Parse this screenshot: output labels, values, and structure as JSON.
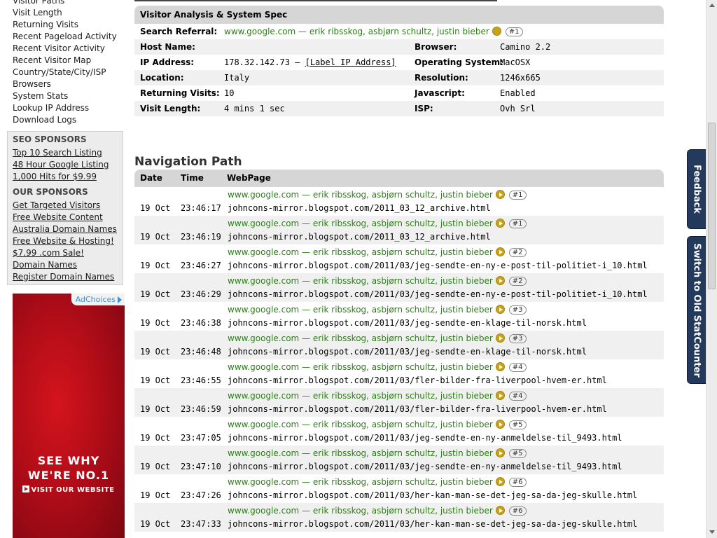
{
  "sidebar": {
    "links": [
      "Visitor Paths",
      "Visit Length",
      "Returning Visits",
      "Recent Pageload Activity",
      "Recent Visitor Activity",
      "Recent Visitor Map",
      "Country/State/City/ISP",
      "Browsers",
      "System Stats",
      "Lookup IP Address",
      "Download Logs"
    ],
    "seo_heading": "SEO SPONSORS",
    "seo_links": [
      "Top 10 Search Listing",
      "48 Hour Google Listing",
      "1,000 Hits for $9.99"
    ],
    "our_heading": "OUR SPONSORS",
    "our_links": [
      "Get Targeted Visitors",
      "Free Website Content",
      "Australia Domain Names",
      "Free Website & Hosting!",
      "$7.99 .com Sale!",
      "Domain Names",
      "Register Domain Names"
    ]
  },
  "ad": {
    "choices_label": "AdChoices",
    "headline_line1": "SEE WHY",
    "headline_line2": "WE'RE NO.1",
    "cta": "VISIT OUR WEBSITE"
  },
  "spec": {
    "title": "Visitor Analysis & System Spec",
    "search_referral_label": "Search Referral:",
    "search_referral_value": "www.google.com — erik ribsskog, asbjørn schultz, justin bieber",
    "search_referral_rank": "#1",
    "host_name_label": "Host Name:",
    "host_name_value": "",
    "browser_label": "Browser:",
    "browser_value": "Camino 2.2",
    "ip_label": "IP Address:",
    "ip_value": "178.32.142.73 —",
    "ip_link": "[Label IP Address]",
    "os_label": "Operating System:",
    "os_value": "MacOSX",
    "location_label": "Location:",
    "location_value": "Italy",
    "resolution_label": "Resolution:",
    "resolution_value": "1246x665",
    "returning_label": "Returning Visits:",
    "returning_value": "10",
    "javascript_label": "Javascript:",
    "javascript_value": "Enabled",
    "visit_length_label": "Visit Length:",
    "visit_length_value": "4 mins 1 sec",
    "isp_label": "ISP:",
    "isp_value": "Ovh Srl"
  },
  "navigation": {
    "title": "Navigation Path",
    "col_date": "Date",
    "col_time": "Time",
    "col_webpage": "WebPage",
    "rows": [
      {
        "date": "19 Oct",
        "time": "23:46:17",
        "referrer": "www.google.com — erik ribsskog, asbjørn schultz, justin bieber",
        "rank": "#1",
        "url": "johncons-mirror.blogspot.com/2011_03_12_archive.html"
      },
      {
        "date": "19 Oct",
        "time": "23:46:19",
        "referrer": "www.google.com — erik ribsskog, asbjørn schultz, justin bieber",
        "rank": "#1",
        "url": "johncons-mirror.blogspot.com/2011_03_12_archive.html"
      },
      {
        "date": "19 Oct",
        "time": "23:46:27",
        "referrer": "www.google.com — erik ribsskog, asbjørn schultz, justin bieber",
        "rank": "#2",
        "url": "johncons-mirror.blogspot.com/2011/03/jeg-sendte-en-ny-e-post-til-politiet-i_10.html"
      },
      {
        "date": "19 Oct",
        "time": "23:46:29",
        "referrer": "www.google.com — erik ribsskog, asbjørn schultz, justin bieber",
        "rank": "#2",
        "url": "johncons-mirror.blogspot.com/2011/03/jeg-sendte-en-ny-e-post-til-politiet-i_10.html"
      },
      {
        "date": "19 Oct",
        "time": "23:46:38",
        "referrer": "www.google.com — erik ribsskog, asbjørn schultz, justin bieber",
        "rank": "#3",
        "url": "johncons-mirror.blogspot.com/2011/03/jeg-sendte-en-klage-til-norsk.html"
      },
      {
        "date": "19 Oct",
        "time": "23:46:48",
        "referrer": "www.google.com — erik ribsskog, asbjørn schultz, justin bieber",
        "rank": "#3",
        "url": "johncons-mirror.blogspot.com/2011/03/jeg-sendte-en-klage-til-norsk.html"
      },
      {
        "date": "19 Oct",
        "time": "23:46:55",
        "referrer": "www.google.com — erik ribsskog, asbjørn schultz, justin bieber",
        "rank": "#4",
        "url": "johncons-mirror.blogspot.com/2011/03/fler-bilder-fra-liverpool-hvem-er.html"
      },
      {
        "date": "19 Oct",
        "time": "23:46:59",
        "referrer": "www.google.com — erik ribsskog, asbjørn schultz, justin bieber",
        "rank": "#4",
        "url": "johncons-mirror.blogspot.com/2011/03/fler-bilder-fra-liverpool-hvem-er.html"
      },
      {
        "date": "19 Oct",
        "time": "23:47:05",
        "referrer": "www.google.com — erik ribsskog, asbjørn schultz, justin bieber",
        "rank": "#5",
        "url": "johncons-mirror.blogspot.com/2011/03/jeg-sendte-en-ny-anmeldelse-til_9493.html"
      },
      {
        "date": "19 Oct",
        "time": "23:47:10",
        "referrer": "www.google.com — erik ribsskog, asbjørn schultz, justin bieber",
        "rank": "#5",
        "url": "johncons-mirror.blogspot.com/2011/03/jeg-sendte-en-ny-anmeldelse-til_9493.html"
      },
      {
        "date": "19 Oct",
        "time": "23:47:26",
        "referrer": "www.google.com — erik ribsskog, asbjørn schultz, justin bieber",
        "rank": "#6",
        "url": "johncons-mirror.blogspot.com/2011/03/her-kan-man-se-det-jeg-sa-da-jeg-skulle.html"
      },
      {
        "date": "19 Oct",
        "time": "23:47:33",
        "referrer": "www.google.com — erik ribsskog, asbjørn schultz, justin bieber",
        "rank": "#6",
        "url": "johncons-mirror.blogspot.com/2011/03/her-kan-man-se-det-jeg-sa-da-jeg-skulle.html"
      }
    ]
  },
  "side_tabs": {
    "feedback": "Feedback",
    "switch": "Switch to Old StatCounter"
  },
  "colors": {
    "accent_green": "#2e7d1a",
    "header_gray": "#d6d6d6",
    "tab_navy": "#233a5c",
    "ad_red": "#c0101a"
  }
}
